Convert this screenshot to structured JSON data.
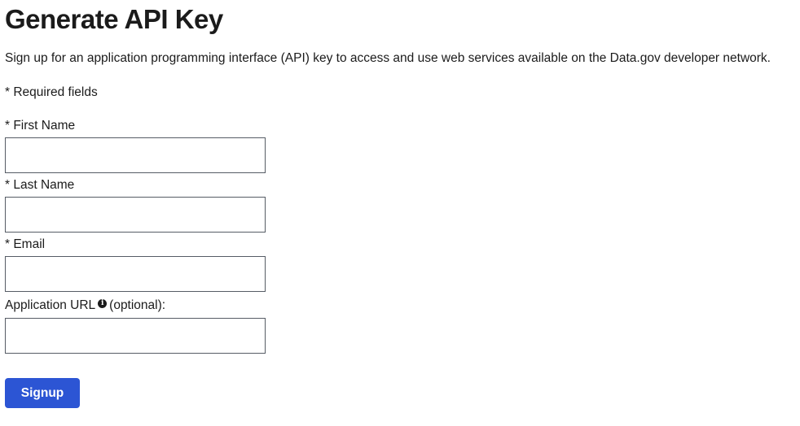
{
  "page": {
    "title": "Generate API Key",
    "intro": "Sign up for an application programming interface (API) key to access and use web services available on the Data.gov developer network.",
    "required_note": "* Required fields"
  },
  "form": {
    "first_name": {
      "label": "* First Name",
      "value": ""
    },
    "last_name": {
      "label": "* Last Name",
      "value": ""
    },
    "email": {
      "label": "* Email",
      "value": ""
    },
    "app_url": {
      "label": "Application URL",
      "label_suffix": "(optional):",
      "info_icon": "info-circle-icon",
      "value": ""
    },
    "submit_label": "Signup"
  },
  "colors": {
    "primary_button": "#2c55d4",
    "text": "#1b1b1b",
    "input_border": "#565c65"
  }
}
